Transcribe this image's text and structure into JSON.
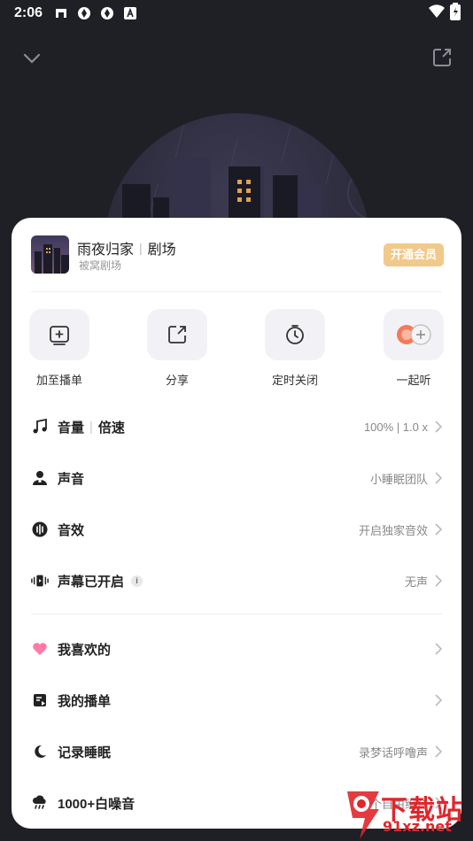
{
  "status_bar": {
    "time": "2:06",
    "icons": [
      "notification-app-icon",
      "sync-icon",
      "sync-icon",
      "text-a-icon"
    ],
    "right_icons": [
      "wifi-icon",
      "battery-charging-icon"
    ]
  },
  "player": {
    "collapse_icon": "chevron-down-icon",
    "share_icon": "share-square-icon"
  },
  "sheet": {
    "header": {
      "title": "雨夜归家",
      "separator": "|",
      "title_suffix": "剧场",
      "subtitle": "被窝剧场",
      "vip_label": "开通会员",
      "vip_color": "#f1c98a"
    },
    "actions": [
      {
        "label": "加至播单",
        "icon": "add-playlist-icon"
      },
      {
        "label": "分享",
        "icon": "share-icon"
      },
      {
        "label": "定时关闭",
        "icon": "timer-icon"
      },
      {
        "label": "一起听",
        "icon": "listen-together-icon"
      }
    ],
    "settings": [
      {
        "label": "音量",
        "label2": "倍速",
        "value": "100% | 1.0 x",
        "icon": "music-note-icon"
      },
      {
        "label": "声音",
        "value": "小睡眠团队",
        "icon": "person-icon"
      },
      {
        "label": "音效",
        "value": "开启独家音效",
        "icon": "sound-effect-icon"
      },
      {
        "label": "声幕已开启",
        "value": "无声",
        "icon": "vibration-icon",
        "info": "i"
      }
    ],
    "menu": [
      {
        "label": "我喜欢的",
        "value": "",
        "icon": "heart-icon"
      },
      {
        "label": "我的播单",
        "value": "",
        "icon": "playlist-icon"
      },
      {
        "label": "记录睡眠",
        "value": "录梦话呼噜声",
        "icon": "moon-icon"
      },
      {
        "label": "1000+白噪音",
        "value": "3个自由组合",
        "icon": "rain-cloud-icon"
      }
    ]
  },
  "watermark": {
    "text": "下载站",
    "url": "91xz.net"
  },
  "colors": {
    "background": "#1f1f26",
    "sheet": "#ffffff",
    "vip": "#f1c98a",
    "heart": "#ff6b9a",
    "watermark": "#e0262b"
  }
}
